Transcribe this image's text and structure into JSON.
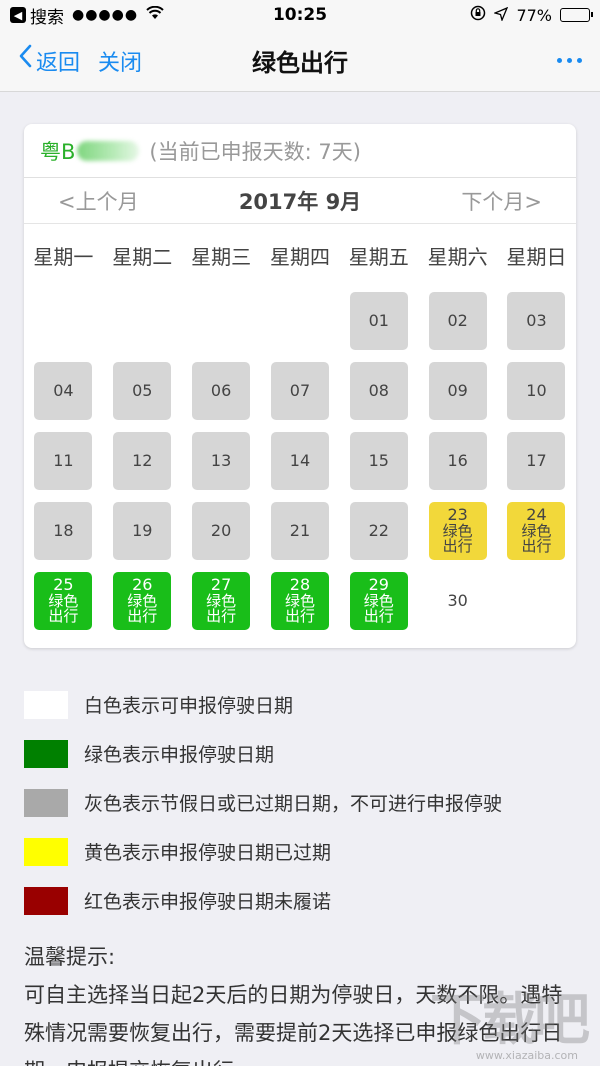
{
  "status_bar": {
    "back_app": "搜索",
    "signal": "●●●●●",
    "time": "10:25",
    "battery_percent": "77%",
    "battery_level": 0.77
  },
  "nav": {
    "back_label": "返回",
    "close_label": "关闭",
    "title": "绿色出行"
  },
  "calendar": {
    "plate_prefix": "粤B",
    "days_declared": "(当前已申报天数: 7天)",
    "prev_month": "<上个月",
    "next_month": "下个月>",
    "month_title": "2017年 9月",
    "weekdays": [
      "星期一",
      "星期二",
      "星期三",
      "星期四",
      "星期五",
      "星期六",
      "星期日"
    ],
    "leading_blanks": 4,
    "days": [
      {
        "day": "01",
        "status": "gray"
      },
      {
        "day": "02",
        "status": "gray"
      },
      {
        "day": "03",
        "status": "gray"
      },
      {
        "day": "04",
        "status": "gray"
      },
      {
        "day": "05",
        "status": "gray"
      },
      {
        "day": "06",
        "status": "gray"
      },
      {
        "day": "07",
        "status": "gray"
      },
      {
        "day": "08",
        "status": "gray"
      },
      {
        "day": "09",
        "status": "gray"
      },
      {
        "day": "10",
        "status": "gray"
      },
      {
        "day": "11",
        "status": "gray"
      },
      {
        "day": "12",
        "status": "gray"
      },
      {
        "day": "13",
        "status": "gray"
      },
      {
        "day": "14",
        "status": "gray"
      },
      {
        "day": "15",
        "status": "gray"
      },
      {
        "day": "16",
        "status": "gray"
      },
      {
        "day": "17",
        "status": "gray"
      },
      {
        "day": "18",
        "status": "gray"
      },
      {
        "day": "19",
        "status": "gray"
      },
      {
        "day": "20",
        "status": "gray"
      },
      {
        "day": "21",
        "status": "gray"
      },
      {
        "day": "22",
        "status": "gray"
      },
      {
        "day": "23",
        "status": "yellow",
        "tag": [
          "绿色",
          "出行"
        ]
      },
      {
        "day": "24",
        "status": "yellow",
        "tag": [
          "绿色",
          "出行"
        ]
      },
      {
        "day": "25",
        "status": "green",
        "tag": [
          "绿色",
          "出行"
        ]
      },
      {
        "day": "26",
        "status": "green",
        "tag": [
          "绿色",
          "出行"
        ]
      },
      {
        "day": "27",
        "status": "green",
        "tag": [
          "绿色",
          "出行"
        ]
      },
      {
        "day": "28",
        "status": "green",
        "tag": [
          "绿色",
          "出行"
        ]
      },
      {
        "day": "29",
        "status": "green",
        "tag": [
          "绿色",
          "出行"
        ]
      },
      {
        "day": "30",
        "status": "white"
      }
    ]
  },
  "legend": [
    {
      "color": "#ffffff",
      "text": "白色表示可申报停驶日期"
    },
    {
      "color": "#008000",
      "text": "绿色表示申报停驶日期"
    },
    {
      "color": "#a9a9a9",
      "text": "灰色表示节假日或已过期日期，不可进行申报停驶"
    },
    {
      "color": "#ffff00",
      "text": "黄色表示申报停驶日期已过期"
    },
    {
      "color": "#990000",
      "text": "红色表示申报停驶日期未履诺"
    }
  ],
  "tips": {
    "title": "温馨提示:",
    "body": "可自主选择当日起2天后的日期为停驶日，天数不限。遇特殊情况需要恢复出行，需要提前2天选择已申报绿色出行日期，申报提交恢复出行。"
  },
  "watermark": {
    "text": "下载吧",
    "sub": "www.xiazaiba.com"
  }
}
